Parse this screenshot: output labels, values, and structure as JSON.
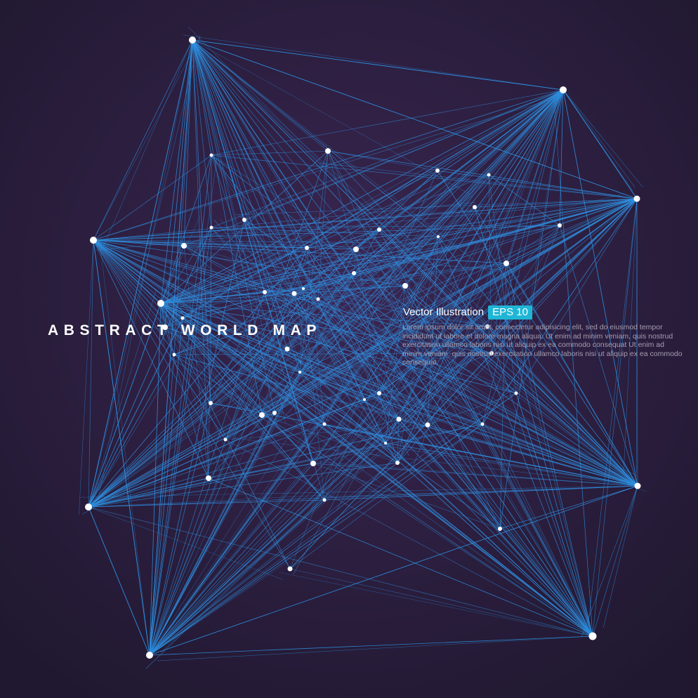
{
  "title": "ABSTRACT WORLD MAP",
  "subtitle": "Vector Illustration",
  "badge": "EPS 10",
  "body_text": "Lorem ipsum dolor sit amet, consectetur adipisicing elit, sed do eiusmod tempor incididunt ut labore et dolore magna aliqua. Ut enim ad minim veniam, quis nostrud exercitation ullamco laboris nisi ut aliquip ex ea commodo consequat Ut enim ad minim veniam, quis nostrud exercitation ullamco laboris nisi ut aliquip ex ea commodo consequat.",
  "colors": {
    "background_center": "#3a2651",
    "background_edge": "#201830",
    "line": "#2f8fe0",
    "node": "#ffffff",
    "badge": "#1fb6d6",
    "body_text": "#a59eb1"
  }
}
